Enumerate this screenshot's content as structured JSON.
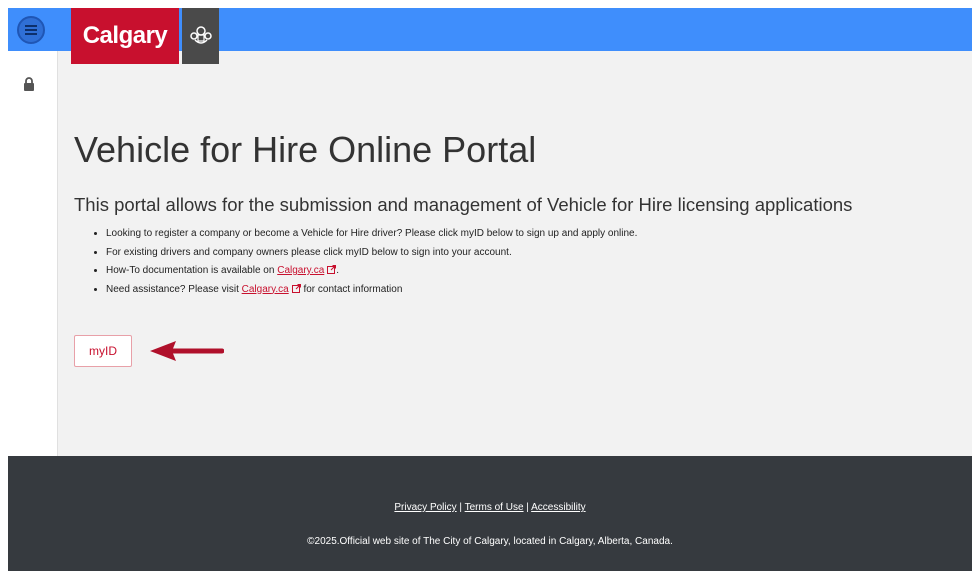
{
  "header": {
    "logo_text": "Calgary"
  },
  "main": {
    "title": "Vehicle for Hire Online Portal",
    "subtitle": "This portal allows for the submission and management of Vehicle for Hire licensing applications",
    "bullets": {
      "b1": "Looking to register a company or become a Vehicle for Hire driver? Please click myID below to sign up and apply online.",
      "b2": "For existing drivers and company owners please click myID below to sign into your account.",
      "b3_prefix": "How-To documentation is available on ",
      "b3_link": "Calgary.ca",
      "b3_suffix": ".",
      "b4_prefix": "Need assistance? Please visit ",
      "b4_link": "Calgary.ca",
      "b4_suffix": " for contact information"
    },
    "myid_button": "myID"
  },
  "footer": {
    "privacy": "Privacy Policy",
    "sep1": " | ",
    "terms": "Terms of Use",
    "sep2": " | ",
    "accessibility": "Accessibility",
    "copyright": "©2025.Official web site of The City of Calgary, located in Calgary, Alberta, Canada."
  },
  "colors": {
    "topbar": "#3f8efc",
    "brand_red": "#c8102e",
    "footer": "#363a3f",
    "background": "#f2f2f2"
  },
  "icons": [
    "menu-icon",
    "crest-icon",
    "lock-icon",
    "external-link-icon",
    "arrow-left-icon"
  ]
}
